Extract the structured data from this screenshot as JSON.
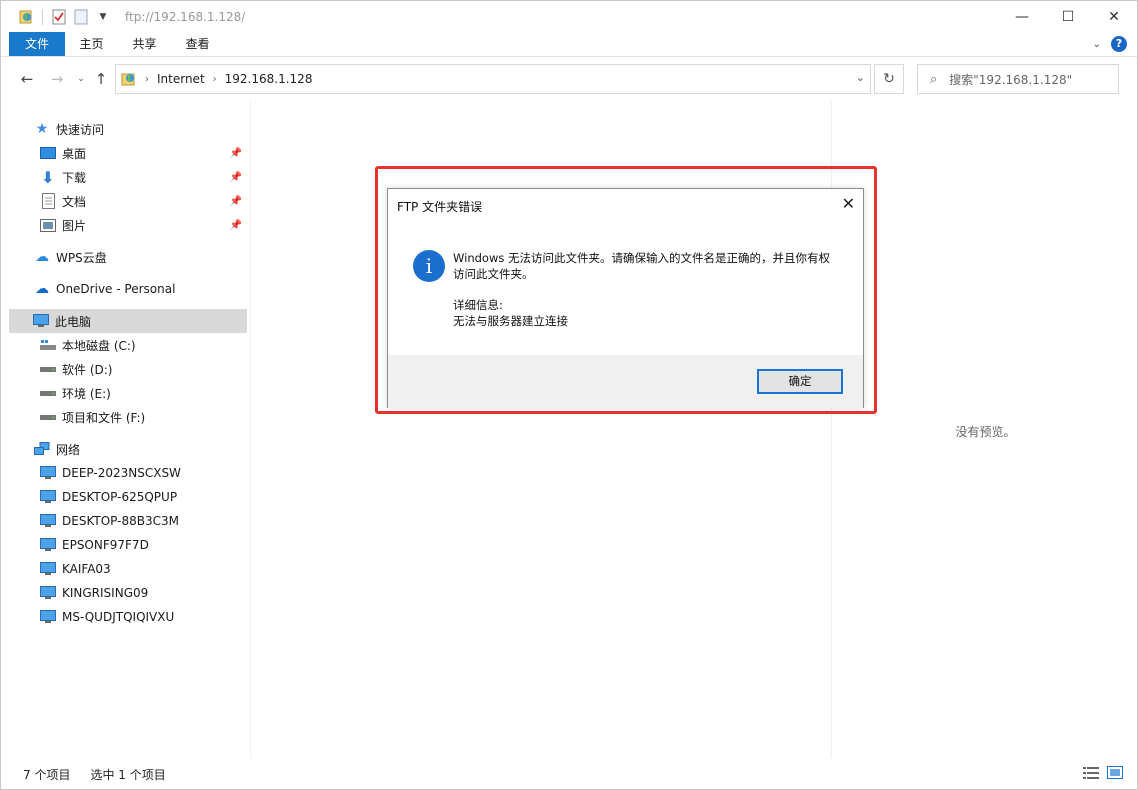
{
  "title_path": "ftp://192.168.1.128/",
  "ribbon": {
    "tabs": [
      "文件",
      "主页",
      "共享",
      "查看"
    ]
  },
  "address": {
    "crumbs": [
      "Internet",
      "192.168.1.128"
    ]
  },
  "search": {
    "placeholder": "搜索\"192.168.1.128\""
  },
  "sidebar": {
    "quick_access": "快速访问",
    "quick_items": [
      "桌面",
      "下载",
      "文档",
      "图片"
    ],
    "wps": "WPS云盘",
    "onedrive": "OneDrive - Personal",
    "this_pc": "此电脑",
    "drives": [
      "本地磁盘 (C:)",
      "软件 (D:)",
      "环境 (E:)",
      "项目和文件 (F:)"
    ],
    "network": "网络",
    "computers": [
      "DEEP-2023NSCXSW",
      "DESKTOP-625QPUP",
      "DESKTOP-88B3C3M",
      "EPSONF97F7D",
      "KAIFA03",
      "KINGRISING09",
      "MS-QUDJTQIQIVXU"
    ]
  },
  "preview": {
    "text": "没有预览。"
  },
  "status": {
    "count": "7 个项目",
    "selected": "选中 1 个项目"
  },
  "dialog": {
    "title": "FTP 文件夹错误",
    "message": "Windows 无法访问此文件夹。请确保输入的文件名是正确的，并且你有权访问此文件夹。",
    "details_label": "详细信息:",
    "details": "无法与服务器建立连接",
    "ok": "确定"
  },
  "colors": {
    "accent": "#1979ca",
    "highlight": "#e8322e"
  }
}
